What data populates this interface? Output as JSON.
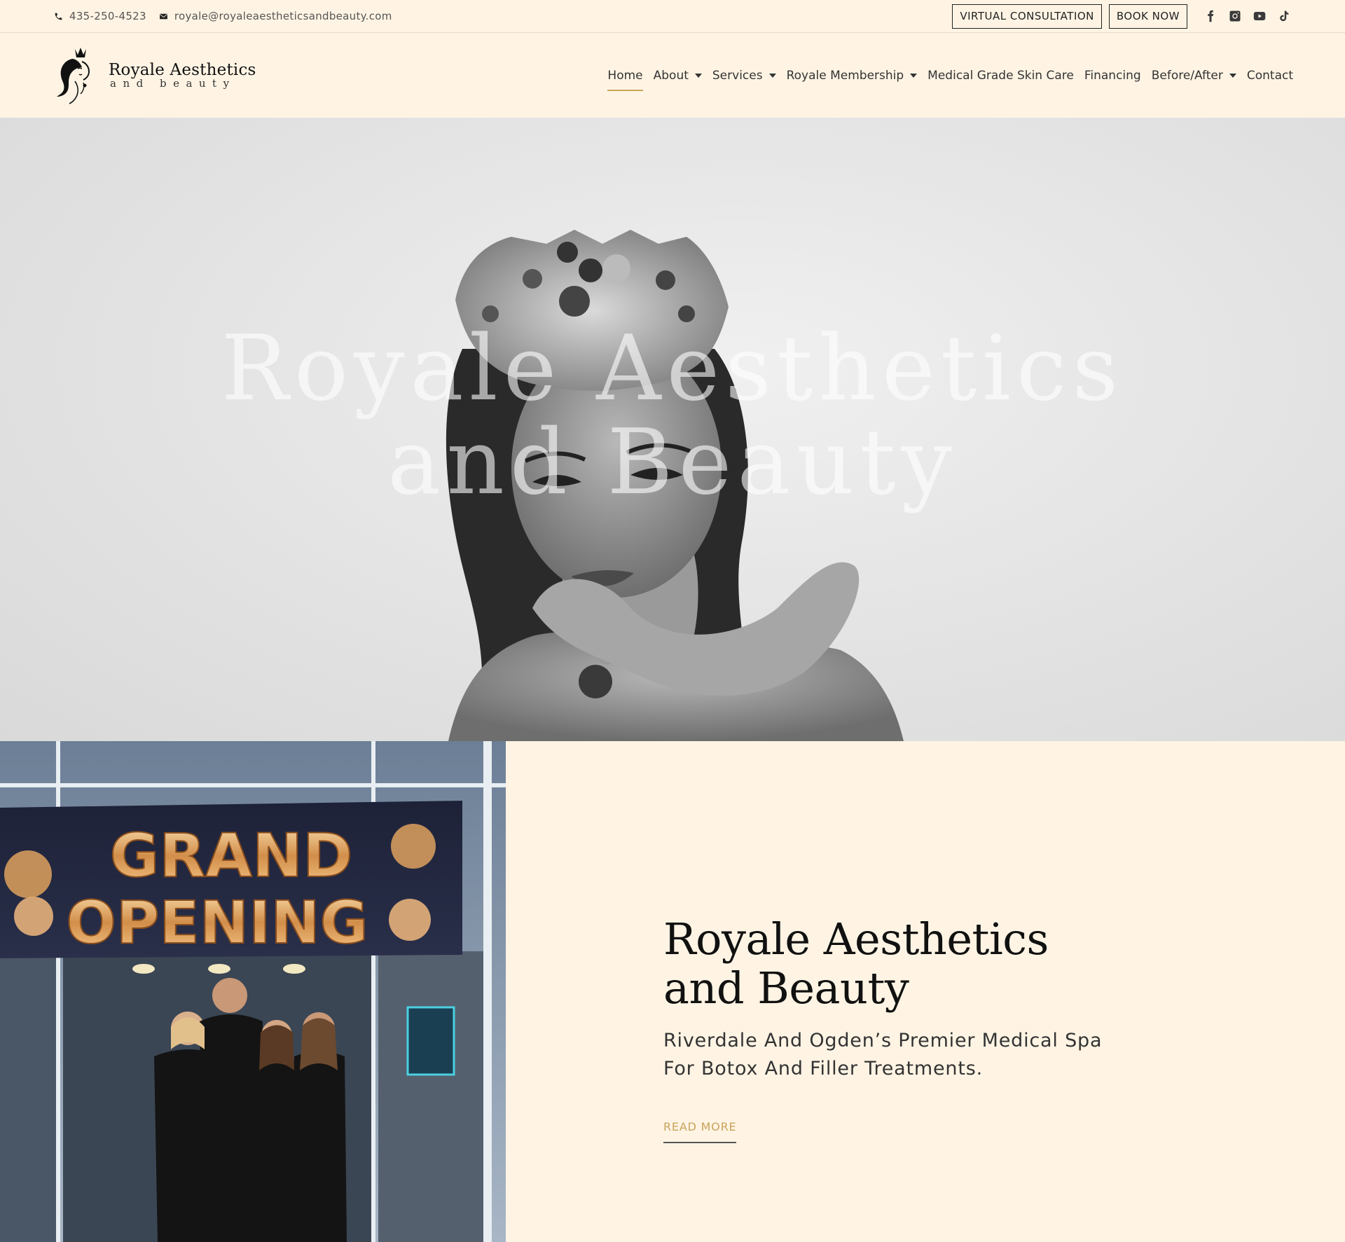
{
  "topbar": {
    "phone": "435-250-4523",
    "email": "royale@royaleaestheticsandbeauty.com",
    "virtual_consultation": "VIRTUAL CONSULTATION",
    "book_now": "BOOK NOW",
    "socials": [
      "facebook-icon",
      "instagram-icon",
      "youtube-icon",
      "tiktok-icon"
    ]
  },
  "header": {
    "logo_name": "Royale Aesthetics",
    "logo_sub": "and beauty",
    "nav": [
      {
        "label": "Home",
        "active": true,
        "dropdown": false
      },
      {
        "label": "About",
        "dropdown": true
      },
      {
        "label": "Services",
        "dropdown": true
      },
      {
        "label": "Royale Membership",
        "dropdown": true
      },
      {
        "label": "Medical Grade Skin Care",
        "dropdown": false
      },
      {
        "label": "Financing",
        "dropdown": false
      },
      {
        "label": "Before/After",
        "dropdown": true
      },
      {
        "label": "Contact",
        "dropdown": false
      }
    ]
  },
  "hero": {
    "title_line1": "Royale Aesthetics",
    "title_line2": "and Beauty"
  },
  "photo": {
    "banner_line1": "GRAND",
    "banner_line2": "OPENING"
  },
  "intro": {
    "heading_line1": "Royale Aesthetics",
    "heading_line2": "and Beauty",
    "tagline": "Riverdale And Ogden’s Premier Medical Spa For Botox And Filler Treatments.",
    "read_more": "READ MORE"
  },
  "colors": {
    "background": "#fff4e4",
    "accent_gold": "#c9a35a",
    "text_dark": "#111111"
  }
}
